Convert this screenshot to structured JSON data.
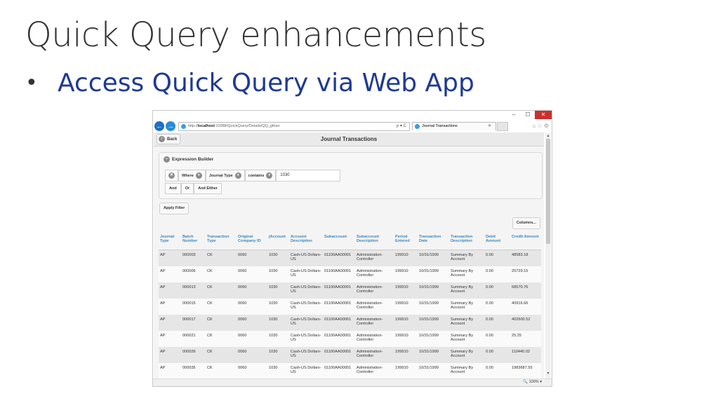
{
  "slide": {
    "title": "Quick Query enhancements",
    "bullet": "Access Quick Query via Web App"
  },
  "browser": {
    "url_prefix": "http://",
    "url_host": "localhost",
    "url_path": ":23088/QuickQuery/Details/QQ_gltran",
    "url_tools": "ρ ▾ C",
    "tab_title": "Journal Transactions",
    "zoom": "100%"
  },
  "app": {
    "back_label": "Back",
    "title": "Journal Transactions",
    "expression_builder": {
      "title": "Expression Builder",
      "where_label": "Where",
      "field_label": "Journal Type",
      "operator_label": "contains",
      "value": "1030",
      "and_label": "And",
      "or_label": "Or",
      "and_either_label": "And Either"
    },
    "apply_filter_label": "Apply Filter",
    "columns_label": "Columns..."
  },
  "grid": {
    "headers": [
      "Journal Type",
      "Batch Number",
      "Transaction Type",
      "Original Company ID",
      "jAccount",
      "Account Description",
      "Subaccount",
      "Subaccount Description",
      "Period Entered",
      "Transaction Date",
      "Transaction Description",
      "Debit Amount",
      "Credit Amount"
    ],
    "rows": [
      [
        "AP",
        "000003",
        "CK",
        "0060",
        "1030",
        "Cash-US Dollars-US",
        "01100AA00001",
        "Administration-Controller",
        "199910",
        "10/31/1999",
        "Summary By Account",
        "0.00",
        "48583.18"
      ],
      [
        "AP",
        "000006",
        "CK",
        "0060",
        "1030",
        "Cash-US Dollars-US",
        "01100AA00001",
        "Administration-Controller",
        "199910",
        "10/31/1999",
        "Summary By Account",
        "0.00",
        "25729.15"
      ],
      [
        "AP",
        "000013",
        "CK",
        "0060",
        "1030",
        "Cash-US Dollars-US",
        "01100AA00001",
        "Administration-Controller",
        "199910",
        "10/31/1999",
        "Summary By Account",
        "0.00",
        "68570.76"
      ],
      [
        "AP",
        "000015",
        "CK",
        "0060",
        "1030",
        "Cash-US Dollars-US",
        "01100AA00001",
        "Administration-Controller",
        "199910",
        "10/31/1999",
        "Summary By Account",
        "0.00",
        "40916.66"
      ],
      [
        "AP",
        "000017",
        "CK",
        "0060",
        "1030",
        "Cash-US Dollars-US",
        "01100AA00001",
        "Administration-Controller",
        "199910",
        "10/31/1999",
        "Summary By Account",
        "0.00",
        "402600.52"
      ],
      [
        "AP",
        "000021",
        "CK",
        "0060",
        "1030",
        "Cash-US Dollars-US",
        "01100AA00001",
        "Administration-Controller",
        "199910",
        "10/31/1999",
        "Summary By Account",
        "0.00",
        "25.25"
      ],
      [
        "AP",
        "000026",
        "CK",
        "0060",
        "1030",
        "Cash-US Dollars-US",
        "01100AA00001",
        "Administration-Controller",
        "199910",
        "10/31/1999",
        "Summary By Account",
        "0.00",
        "110440.02"
      ],
      [
        "AP",
        "000035",
        "CK",
        "0060",
        "1030",
        "Cash-US Dollars-US",
        "01100AA00001",
        "Administration-Controller",
        "199910",
        "10/31/1999",
        "Summary By Account",
        "0.00",
        "1983687.55"
      ]
    ]
  },
  "colors": {
    "title_text": "#333333",
    "bullet_text": "#1f3a93",
    "header_link": "#3a87c7",
    "close_button": "#c9302c"
  }
}
